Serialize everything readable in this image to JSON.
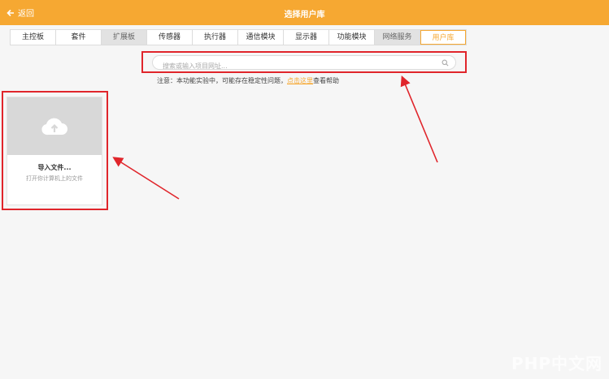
{
  "header": {
    "back_label": "返回",
    "title": "选择用户库"
  },
  "tabs": [
    {
      "label": "主控板",
      "state": "normal"
    },
    {
      "label": "套件",
      "state": "normal"
    },
    {
      "label": "扩展板",
      "state": "gray"
    },
    {
      "label": "传感器",
      "state": "normal"
    },
    {
      "label": "执行器",
      "state": "normal"
    },
    {
      "label": "通信模块",
      "state": "normal"
    },
    {
      "label": "显示器",
      "state": "normal"
    },
    {
      "label": "功能模块",
      "state": "normal"
    },
    {
      "label": "网络服务",
      "state": "gray"
    },
    {
      "label": "用户库",
      "state": "active"
    }
  ],
  "search": {
    "placeholder": "搜索或输入项目网址..."
  },
  "notice": {
    "prefix": "注意：本功能实验中，可能存在稳定性问题，",
    "link": "点击这里",
    "suffix": "查看帮助"
  },
  "import_card": {
    "title": "导入文件...",
    "subtitle": "打开你计算机上的文件"
  },
  "colors": {
    "accent": "#f6a832",
    "annotation_red": "#e0252b"
  },
  "watermark": "PHP中文网"
}
